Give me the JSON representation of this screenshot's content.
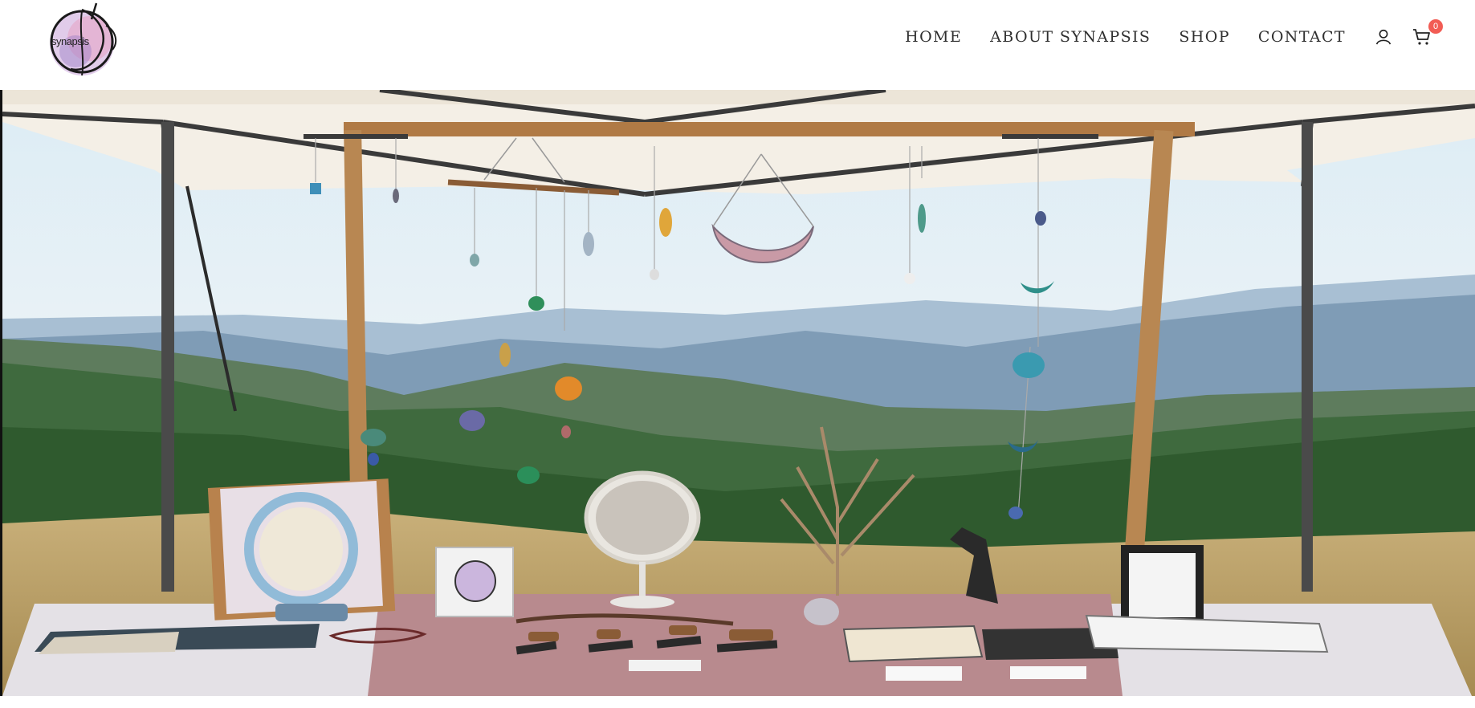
{
  "brand": {
    "logo_text": "synapsis"
  },
  "nav": {
    "items": [
      {
        "label": "HOME"
      },
      {
        "label": "ABOUT SYNAPSIS"
      },
      {
        "label": "SHOP"
      },
      {
        "label": "CONTACT"
      }
    ],
    "account_icon": "user-icon",
    "cart_icon": "cart-icon",
    "cart_count": "0"
  },
  "colors": {
    "nav_text": "#2f2f2f",
    "badge": "#f25c54"
  }
}
